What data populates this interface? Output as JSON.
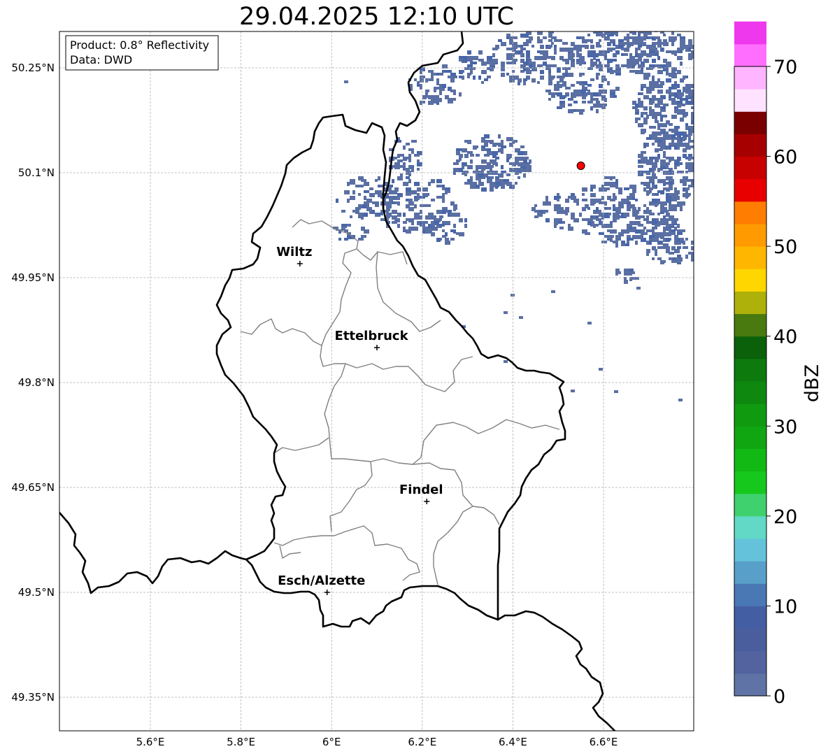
{
  "title": "29.04.2025 12:10 UTC",
  "info_box": {
    "line1": "Product: 0.8° Reflectivity",
    "line2": "Data: DWD"
  },
  "lat_ticks": [
    "50.25°N",
    "50.1°N",
    "49.95°N",
    "49.8°N",
    "49.65°N",
    "49.5°N",
    "49.35°N"
  ],
  "lon_ticks": [
    "5.6°E",
    "5.8°E",
    "6°E",
    "6.2°E",
    "6.4°E",
    "6.6°E"
  ],
  "cities": [
    {
      "name": "Wiltz",
      "lon": 5.93,
      "lat": 49.97
    },
    {
      "name": "Ettelbruck",
      "lon": 6.1,
      "lat": 49.85
    },
    {
      "name": "Findel",
      "lon": 6.21,
      "lat": 49.63
    },
    {
      "name": "Esch/Alzette",
      "lon": 5.99,
      "lat": 49.5
    }
  ],
  "radar_site": {
    "lon": 6.55,
    "lat": 50.11,
    "color": "#ff0000"
  },
  "colorbar": {
    "label": "dBZ",
    "ticks": [
      "0",
      "10",
      "20",
      "30",
      "40",
      "50",
      "60",
      "70"
    ],
    "min": 0,
    "max": 70,
    "step": 2.5,
    "colors": [
      "#6073a6",
      "#5263a0",
      "#4a5e9d",
      "#445ea4",
      "#4a78b4",
      "#58a0c9",
      "#64c3db",
      "#62d8c7",
      "#3fd16e",
      "#16c81c",
      "#12b814",
      "#10a612",
      "#0f9a10",
      "#0f8810",
      "#0d7a0e",
      "#0a610a",
      "#487a10",
      "#adb109",
      "#ffd600",
      "#ffb600",
      "#ff9b00",
      "#ff7d00",
      "#e80000",
      "#c70000",
      "#a70000",
      "#7a0000",
      "#ffe2ff",
      "#ffb5ff",
      "#ff6eff",
      "#ee38ee"
    ]
  },
  "colors": {
    "echo_light": "#5a6fa3",
    "echo_dark": "#4866a8",
    "country_border": "#000000",
    "canton_border": "#808080",
    "grid": "#b0b0b0"
  }
}
